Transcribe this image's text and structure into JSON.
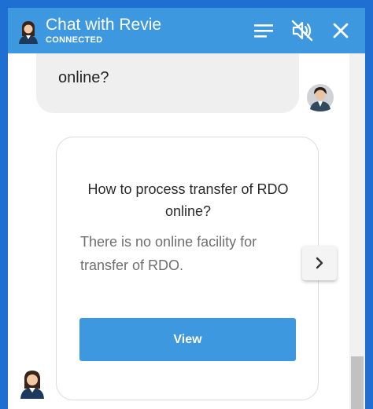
{
  "header": {
    "title": "Chat with Revie",
    "status": "CONNECTED",
    "icons": [
      "menu-icon",
      "mute-icon",
      "close-icon"
    ]
  },
  "conversation": {
    "user_message": "online?",
    "card": {
      "question": "How to process transfer of RDO online?",
      "answer": "There is no online facility for transfer of RDO.",
      "button_label": "View"
    }
  },
  "colors": {
    "header_bg": "#3d98e0",
    "button_bg": "#3d98e0",
    "frame": "#1e6fd1"
  }
}
